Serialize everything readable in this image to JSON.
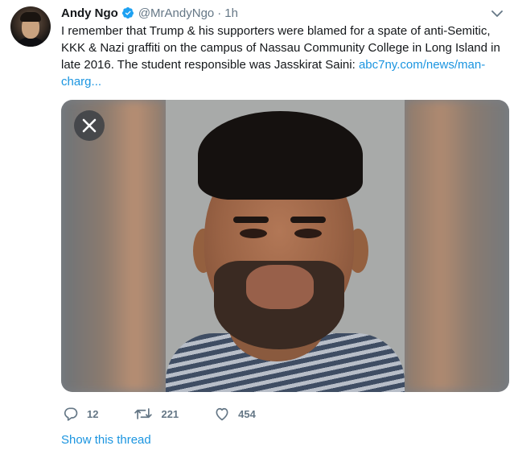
{
  "tweet": {
    "author_name": "Andy Ngo",
    "handle": "@MrAndyNgo",
    "separator": "·",
    "time": "1h",
    "text_line": "I remember that Trump & his supporters were blamed for a spate of anti-Semitic, KKK & Nazi graffiti on the campus of Nassau Community College in Long Island in late 2016. The student responsible was Jasskirat Saini:",
    "link_text": "abc7ny.com/news/man-charg...",
    "replies": "12",
    "retweets": "221",
    "likes": "454",
    "show_thread": "Show this thread"
  },
  "colors": {
    "link": "#1b95e0",
    "muted": "#657786",
    "verified": "#1da1f2"
  },
  "icons": [
    "verified-badge-icon",
    "chevron-down-icon",
    "close-icon",
    "reply-icon",
    "retweet-icon",
    "like-icon"
  ]
}
